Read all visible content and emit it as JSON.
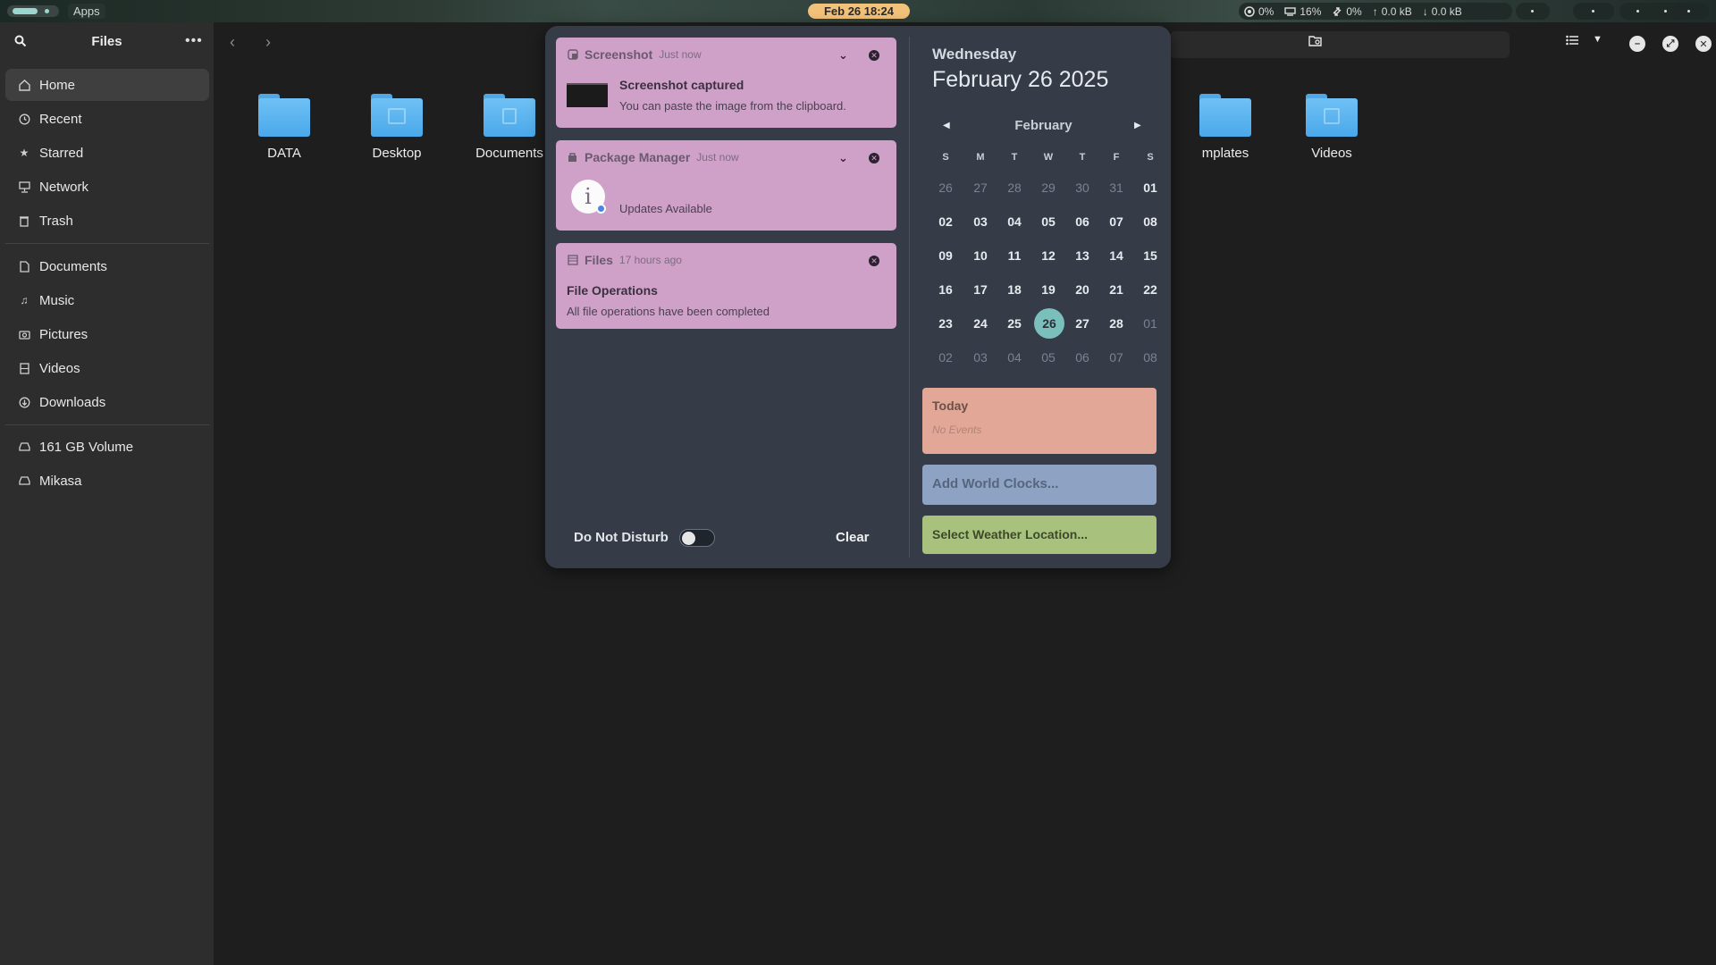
{
  "topbar": {
    "apps_label": "Apps",
    "clock": "Feb 26  18:24",
    "cpu": "0%",
    "memory": "16%",
    "swap": "0%",
    "upload": "0.0 kB",
    "download": "0.0 kB",
    "accent": "#9ad6cf",
    "clock_color": "#f2c27a"
  },
  "sidebar": {
    "title": "Files",
    "items": [
      {
        "label": "Home",
        "icon": "home-icon"
      },
      {
        "label": "Recent",
        "icon": "clock-icon"
      },
      {
        "label": "Starred",
        "icon": "star-icon"
      },
      {
        "label": "Network",
        "icon": "network-icon"
      },
      {
        "label": "Trash",
        "icon": "trash-icon"
      },
      {
        "label": "Documents",
        "icon": "document-icon"
      },
      {
        "label": "Music",
        "icon": "music-icon"
      },
      {
        "label": "Pictures",
        "icon": "camera-icon"
      },
      {
        "label": "Videos",
        "icon": "film-icon"
      },
      {
        "label": "Downloads",
        "icon": "download-icon"
      },
      {
        "label": "161 GB Volume",
        "icon": "drive-icon"
      },
      {
        "label": "Mikasa",
        "icon": "drive-icon"
      }
    ]
  },
  "folders": [
    {
      "label": "DATA"
    },
    {
      "label": "Desktop"
    },
    {
      "label": "Documents"
    },
    {
      "label": "mplates"
    },
    {
      "label": "Videos"
    }
  ],
  "notifications": [
    {
      "app": "Screenshot",
      "time": "Just now",
      "title": "Screenshot captured",
      "body": "You can paste the image from the clipboard."
    },
    {
      "app": "Package Manager",
      "time": "Just now",
      "title": "",
      "body": "Updates Available"
    },
    {
      "app": "Files",
      "time": "17 hours ago",
      "title": "File Operations",
      "body": "All file operations have been completed"
    }
  ],
  "notification_color": "#cfa1c9",
  "dnd_label": "Do Not Disturb",
  "dnd_enabled": false,
  "clear_label": "Clear",
  "calendar": {
    "weekday": "Wednesday",
    "date": "February 26 2025",
    "month": "February",
    "dow": [
      "S",
      "M",
      "T",
      "W",
      "T",
      "F",
      "S"
    ],
    "weeks": [
      [
        "26",
        "27",
        "28",
        "29",
        "30",
        "31",
        "01"
      ],
      [
        "02",
        "03",
        "04",
        "05",
        "06",
        "07",
        "08"
      ],
      [
        "09",
        "10",
        "11",
        "12",
        "13",
        "14",
        "15"
      ],
      [
        "16",
        "17",
        "18",
        "19",
        "20",
        "21",
        "22"
      ],
      [
        "23",
        "24",
        "25",
        "26",
        "27",
        "28",
        "01"
      ],
      [
        "02",
        "03",
        "04",
        "05",
        "06",
        "07",
        "08"
      ]
    ],
    "today": "26",
    "today_color": "#7bbfbc"
  },
  "events": {
    "title": "Today",
    "empty": "No Events",
    "color": "#e2a796"
  },
  "world_clocks_label": "Add World Clocks...",
  "weather_label": "Select Weather Location..."
}
